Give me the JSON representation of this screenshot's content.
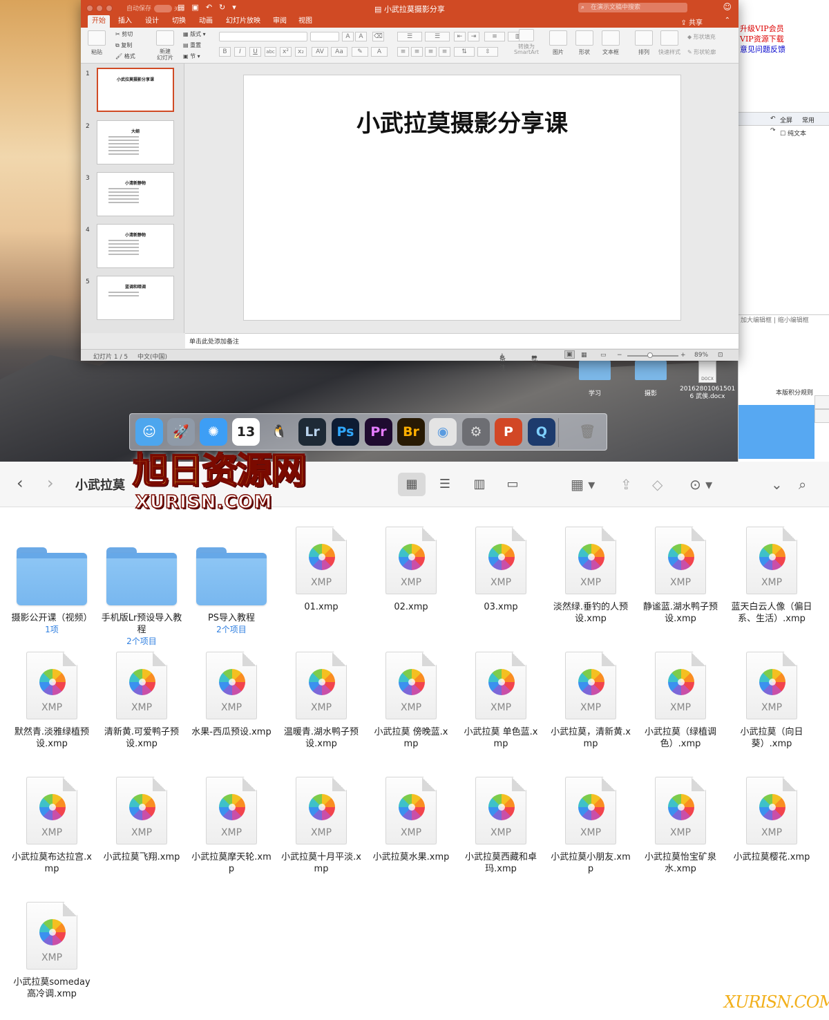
{
  "browser_bg": {
    "links": [
      "升级VIP会员",
      "VIP资源下载",
      "意见问题反馈"
    ],
    "fullscreen": "全屏",
    "common": "常用",
    "plaintext": "纯文本",
    "editor_sizes": "加大编辑框 | 缩小编辑框",
    "points_rule": "本版积分规则"
  },
  "desktop_icons": [
    {
      "label": "学习",
      "type": "folder"
    },
    {
      "label": "摄影",
      "type": "folder"
    },
    {
      "label": "20162801061501 6 武俟.docx",
      "type": "docx"
    }
  ],
  "ppt": {
    "autosave": "自动保存",
    "autosave_state": "关闭",
    "title": "小武拉莫摄影分享",
    "search_placeholder": "在演示文稿中搜索",
    "share": "共享",
    "tabs": [
      "开始",
      "插入",
      "设计",
      "切换",
      "动画",
      "幻灯片放映",
      "审阅",
      "视图"
    ],
    "active_tab": "开始",
    "ribbon": {
      "paste": "粘贴",
      "cut": "剪切",
      "copy": "复制",
      "format": "格式",
      "new_slide": "新建\n幻灯片",
      "layout": "版式",
      "reset": "重置",
      "section": "节",
      "convert": "转换为\nSmartArt",
      "picture": "图片",
      "shape": "形状",
      "textbox": "文本框",
      "arrange": "排列",
      "quick_styles": "快速样式",
      "shape_fill": "形状填充",
      "shape_outline": "形状轮廓"
    },
    "slides": [
      {
        "num": "1",
        "title": "小武拉莫摄影分享课",
        "lines": 0
      },
      {
        "num": "2",
        "title": "大纲",
        "lines": 6
      },
      {
        "num": "3",
        "title": "小清新静物",
        "lines": 6
      },
      {
        "num": "4",
        "title": "小清新静物",
        "lines": 6
      },
      {
        "num": "5",
        "title": "蓝调和暗调",
        "lines": 2
      }
    ],
    "current_slide_title": "小武拉莫摄影分享课",
    "notes_placeholder": "单击此处添加备注",
    "status": {
      "slide_count": "幻灯片 1 / 5",
      "language": "中文(中国)",
      "notes": "备注",
      "comments": "批注",
      "zoom": "89%",
      "zoom_level": 0.45
    }
  },
  "dock": [
    {
      "name": "finder",
      "glyph": "☺",
      "bg": "#4da6ee",
      "fg": "#fff"
    },
    {
      "name": "launchpad",
      "glyph": "🚀",
      "bg": "#8f9aa8",
      "fg": "#fff"
    },
    {
      "name": "safari",
      "glyph": "✺",
      "bg": "#3d9ef5",
      "fg": "#fff"
    },
    {
      "name": "calendar",
      "glyph": "13",
      "bg": "#ffffff",
      "fg": "#222"
    },
    {
      "name": "qq",
      "glyph": "🐧",
      "bg": "transparent",
      "fg": "#000"
    },
    {
      "name": "lightroom",
      "glyph": "Lr",
      "bg": "#1e2a36",
      "fg": "#b9d3ed"
    },
    {
      "name": "photoshop",
      "glyph": "Ps",
      "bg": "#0d1c33",
      "fg": "#30a8ff"
    },
    {
      "name": "premiere",
      "glyph": "Pr",
      "bg": "#1f0b30",
      "fg": "#e67cff"
    },
    {
      "name": "bridge",
      "glyph": "Br",
      "bg": "#281a04",
      "fg": "#ffb000"
    },
    {
      "name": "aperture",
      "glyph": "◉",
      "bg": "#e4e4e4",
      "fg": "#5a9be0"
    },
    {
      "name": "system-prefs",
      "glyph": "⚙",
      "bg": "#6d6e73",
      "fg": "#ddd"
    },
    {
      "name": "powerpoint",
      "glyph": "P",
      "bg": "#d24726",
      "fg": "#fff"
    },
    {
      "name": "quicktime",
      "glyph": "Q",
      "bg": "#1d3b6d",
      "fg": "#7fd0ff"
    },
    {
      "name": "trash",
      "glyph": "🗑",
      "bg": "transparent",
      "fg": "#888"
    }
  ],
  "watermark": {
    "zh": "旭日资源网",
    "en": "XURISN.COM",
    "corner": "XURISN.COM"
  },
  "finder": {
    "folder_title": "小武拉莫",
    "items": [
      {
        "kind": "folder",
        "name": "摄影公开课（视频）",
        "sub": "1项"
      },
      {
        "kind": "folder",
        "name": "手机版Lr预设导入教程",
        "sub": "2个项目"
      },
      {
        "kind": "folder",
        "name": "PS导入教程",
        "sub": "2个项目"
      },
      {
        "kind": "xmp",
        "name": "01.xmp"
      },
      {
        "kind": "xmp",
        "name": "02.xmp"
      },
      {
        "kind": "xmp",
        "name": "03.xmp"
      },
      {
        "kind": "xmp",
        "name": "淡然绿.垂钓的人预设.xmp"
      },
      {
        "kind": "xmp",
        "name": "静谧蓝.湖水鸭子预设.xmp"
      },
      {
        "kind": "xmp",
        "name": "蓝天白云人像（偏日系、生活）.xmp"
      },
      {
        "kind": "xmp",
        "name": "默然青.淡雅绿植预设.xmp"
      },
      {
        "kind": "xmp",
        "name": "清新黄.可爱鸭子预设.xmp"
      },
      {
        "kind": "xmp",
        "name": "水果-西瓜预设.xmp"
      },
      {
        "kind": "xmp",
        "name": "温暖青.湖水鸭子预设.xmp"
      },
      {
        "kind": "xmp",
        "name": "小武拉莫  傍晚蓝.xmp"
      },
      {
        "kind": "xmp",
        "name": "小武拉莫 单色蓝.xmp"
      },
      {
        "kind": "xmp",
        "name": "小武拉莫，清新黄.xmp"
      },
      {
        "kind": "xmp",
        "name": "小武拉莫（绿植调色）.xmp"
      },
      {
        "kind": "xmp",
        "name": "小武拉莫（向日葵）.xmp"
      },
      {
        "kind": "xmp",
        "name": "小武拉莫布达拉宫.xmp"
      },
      {
        "kind": "xmp",
        "name": "小武拉莫飞翔.xmp"
      },
      {
        "kind": "xmp",
        "name": "小武拉莫摩天轮.xmp"
      },
      {
        "kind": "xmp",
        "name": "小武拉莫十月平淡.xmp"
      },
      {
        "kind": "xmp",
        "name": "小武拉莫水果.xmp"
      },
      {
        "kind": "xmp",
        "name": "小武拉莫西藏和卓玛.xmp"
      },
      {
        "kind": "xmp",
        "name": "小武拉莫小朋友.xmp"
      },
      {
        "kind": "xmp",
        "name": "小武拉莫怡宝矿泉水.xmp"
      },
      {
        "kind": "xmp",
        "name": "小武拉莫樱花.xmp"
      },
      {
        "kind": "xmp",
        "name": "小武拉莫someday高冷调.xmp"
      }
    ],
    "xmp_label": "XMP"
  }
}
